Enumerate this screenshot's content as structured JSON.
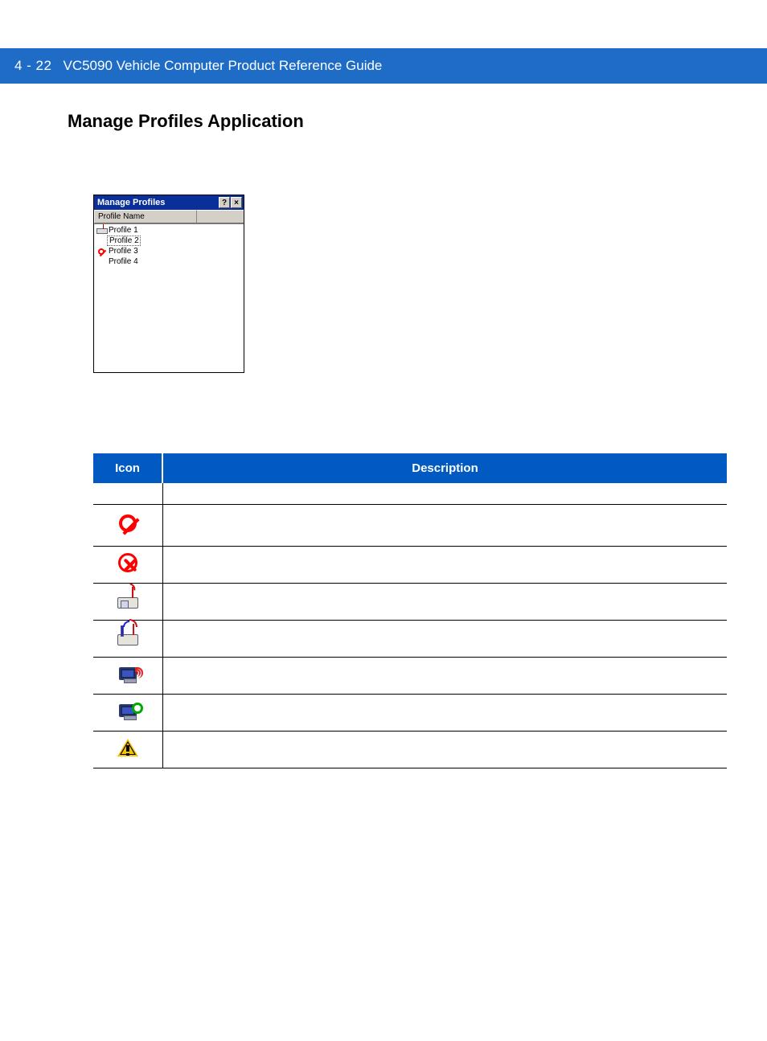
{
  "header": {
    "page": "4 - 22",
    "title": "VC5090 Vehicle Computer Product Reference Guide"
  },
  "section_title": "Manage Profiles Application",
  "window": {
    "title": "Manage Profiles",
    "help": "?",
    "close": "×",
    "col_header": "Profile Name",
    "rows": [
      {
        "icon": "connected",
        "label": "Profile 1"
      },
      {
        "icon": "none",
        "label": "Profile 2",
        "selected": true
      },
      {
        "icon": "disabled",
        "label": "Profile 3"
      },
      {
        "icon": "none",
        "label": "Profile 4"
      }
    ]
  },
  "table": {
    "head_icon": "Icon",
    "head_desc": "Description",
    "rows": [
      {
        "icon": "none",
        "desc": ""
      },
      {
        "icon": "nosymbol",
        "desc": ""
      },
      {
        "icon": "x-circle",
        "desc": ""
      },
      {
        "icon": "ap-single",
        "desc": ""
      },
      {
        "icon": "ap-dual",
        "desc": ""
      },
      {
        "icon": "monitor-tx",
        "desc": ""
      },
      {
        "icon": "monitor-cfg",
        "desc": ""
      },
      {
        "icon": "warning",
        "desc": ""
      }
    ]
  }
}
